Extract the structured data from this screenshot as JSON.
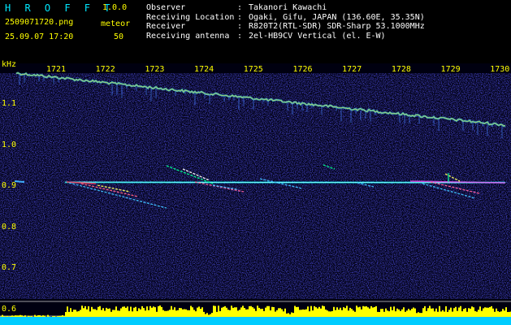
{
  "header": {
    "app_name": "H R O F F T",
    "version": "1.0.0",
    "filename": "2509071720.png",
    "datetime": "25.09.07 17:20",
    "mode": "meteor",
    "count": "50",
    "fields": [
      {
        "label": "Observer",
        "value": "Takanori Kawachi"
      },
      {
        "label": "Receiving Location",
        "value": "Ogaki, Gifu, JAPAN (136.60E, 35.35N)"
      },
      {
        "label": "Receiver",
        "value": "R820T2(RTL-SDR) SDR-Sharp 53.1000MHz"
      },
      {
        "label": "Receiving antenna",
        "value": "2el-HB9CV Vertical (el. E-W)"
      }
    ]
  },
  "axis": {
    "y_unit": "kHz",
    "x_ticks": [
      "1721",
      "1722",
      "1723",
      "1724",
      "1725",
      "1726",
      "1727",
      "1728",
      "1729",
      "1730"
    ],
    "y_ticks": [
      "1.1",
      "1.0",
      "0.9",
      "0.8",
      "0.7",
      "0.6"
    ]
  },
  "colors": {
    "background": "#000000",
    "noise": "#14148c",
    "carrier": "#00ffff",
    "label": "#ffff00",
    "title": "#00e8ff",
    "signal_strip_fill": "#ffff00",
    "signal_strip_base": "#00ccff"
  }
}
